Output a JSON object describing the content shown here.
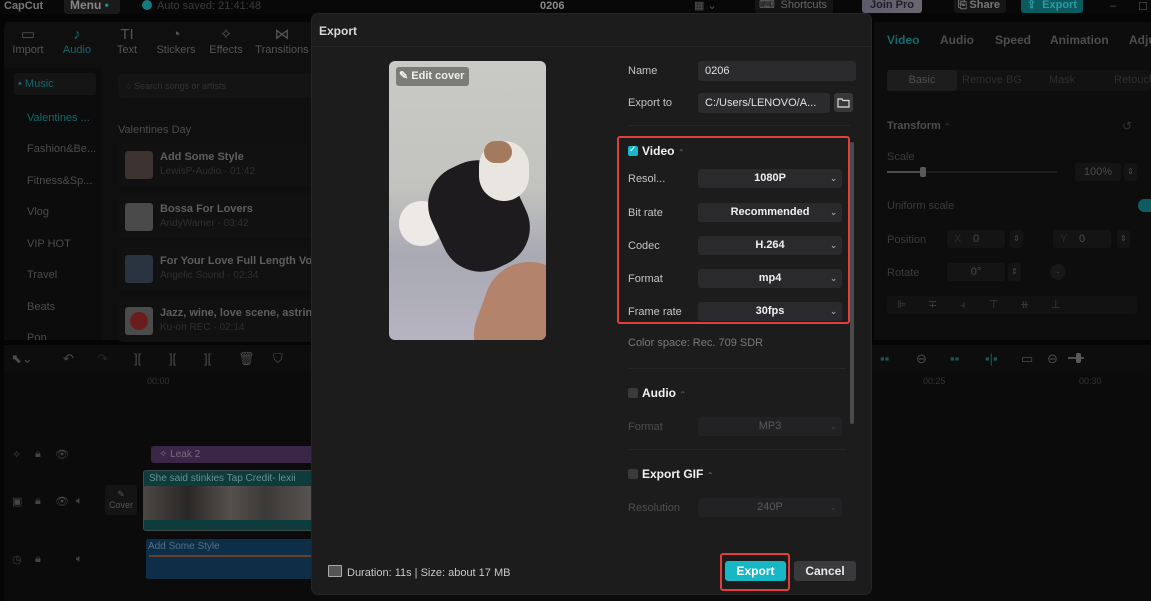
{
  "app": {
    "logo": "CapCut",
    "menu_label": "Menu",
    "autosave": "Auto saved: 21:41:48",
    "project_title": "0206",
    "shortcuts_label": "Shortcuts",
    "join_pro_label": "Join Pro",
    "share_label": "Share",
    "export_label": "Export"
  },
  "toolbar": {
    "tabs": [
      {
        "label": "Import",
        "icon": "import-icon"
      },
      {
        "label": "Audio",
        "icon": "audio-icon",
        "active": true
      },
      {
        "label": "Text",
        "icon": "text-icon"
      },
      {
        "label": "Stickers",
        "icon": "stickers-icon"
      },
      {
        "label": "Effects",
        "icon": "effects-icon"
      },
      {
        "label": "Transitions",
        "icon": "transitions-icon"
      }
    ]
  },
  "audio_panel": {
    "music_header": "Music",
    "categories": [
      "Valentines ...",
      "Fashion&Be...",
      "Fitness&Sp...",
      "Vlog",
      "VIP HOT",
      "Travel",
      "Beats",
      "Pop"
    ],
    "search_placeholder": "Search songs or artists",
    "section_title": "Valentines Day",
    "songs": [
      {
        "title": "Add Some Style",
        "sub": "LewisP-Audio · 01:42"
      },
      {
        "title": "Bossa For Lovers",
        "sub": "AndyWamer · 03:42"
      },
      {
        "title": "For Your Love Full Length Vo",
        "sub": "Angelic Sound · 02:34"
      },
      {
        "title": "Jazz, wine, love scene, astrin",
        "sub": "Ku-on REC · 02:14"
      }
    ]
  },
  "inspector": {
    "tabs": [
      "Video",
      "Audio",
      "Speed",
      "Animation",
      "Adju"
    ],
    "subtabs": [
      "Basic",
      "Remove BG",
      "Mask",
      "Retouch"
    ],
    "transform_title": "Transform",
    "scale_label": "Scale",
    "scale_value": "100%",
    "uniform_scale_label": "Uniform scale",
    "position_label": "Position",
    "pos_x_label": "X",
    "pos_x": "0",
    "pos_y_label": "Y",
    "pos_y": "0",
    "rotate_label": "Rotate",
    "rotate_value": "0°"
  },
  "timeline": {
    "ticks": [
      "00:00",
      "00:25",
      "00:30"
    ],
    "effect_clip": "Leak 2",
    "video_clip_caption": "She said  stinkies  Tap  Credit- lexii",
    "cover_label": "Cover",
    "audio_clip": "Add Some Style"
  },
  "export_dialog": {
    "title": "Export",
    "edit_cover": "Edit cover",
    "name_label": "Name",
    "name_value": "0206",
    "export_to_label": "Export to",
    "export_to_value": "C:/Users/LENOVO/A...",
    "video": {
      "title": "Video",
      "checked": true,
      "rows": [
        {
          "label": "Resol...",
          "value": "1080P"
        },
        {
          "label": "Bit rate",
          "value": "Recommended"
        },
        {
          "label": "Codec",
          "value": "H.264"
        },
        {
          "label": "Format",
          "value": "mp4"
        },
        {
          "label": "Frame rate",
          "value": "30fps"
        }
      ],
      "color_space": "Color space: Rec. 709 SDR"
    },
    "audio": {
      "title": "Audio",
      "checked": false,
      "format_label": "Format",
      "format_value": "MP3"
    },
    "gif": {
      "title": "Export GIF",
      "checked": false,
      "resolution_label": "Resolution",
      "resolution_value": "240P"
    },
    "footer_info": "Duration: 11s | Size: about 17 MB",
    "export_button": "Export",
    "cancel_button": "Cancel"
  },
  "colors": {
    "accent": "#18b7c6",
    "highlight_box": "#e0403d"
  }
}
